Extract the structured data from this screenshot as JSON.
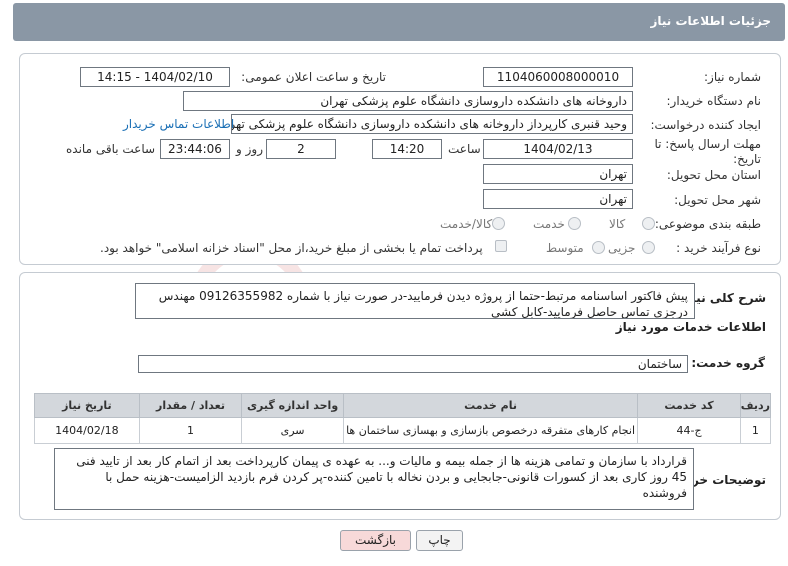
{
  "header": {
    "title": "جزئیات اطلاعات نیاز"
  },
  "need": {
    "number_label": "شماره نیاز:",
    "number_value": "1104060008000010",
    "announce_label": "تاریخ و ساعت اعلان عمومی:",
    "announce_value": "1404/02/10 - 14:15",
    "buyer_label": "نام دستگاه خریدار:",
    "buyer_value": "داروخانه های دانشکده داروسازی دانشگاه علوم پزشکی تهران",
    "creator_label": "ایجاد کننده درخواست:",
    "creator_value": "وحید قنبری کارپرداز داروخانه های دانشکده داروسازی دانشگاه علوم پزشکی تهران",
    "contact_link": "اطلاعات تماس خریدار",
    "deadline_label": "مهلت ارسال پاسخ: تا تاریخ:",
    "deadline_date": "1404/02/13",
    "time_label": "ساعت",
    "deadline_time": "14:20",
    "days_value": "2",
    "days_label": "روز و",
    "remaining_time": "23:44:06",
    "remaining_label": "ساعت باقی مانده",
    "province_label": "استان محل تحویل:",
    "province_value": "تهران",
    "city_label": "شهر محل تحویل:",
    "city_value": "تهران",
    "category_label": "طبقه بندی موضوعی:",
    "category_options": [
      "کالا",
      "خدمت",
      "کالا/خدمت"
    ],
    "process_label": "نوع فرآیند خرید :",
    "process_options": [
      "جزیی",
      "متوسط"
    ],
    "payment_note": "پرداخت تمام یا بخشی از مبلغ خرید،از محل \"اسناد خزانه اسلامی\" خواهد بود."
  },
  "description": {
    "label": "شرح کلی نیاز:",
    "text": "پیش فاکتور اساسنامه مرتبط-حتما از پروژه دیدن فرمایید-در صورت نیاز با شماره 09126355982 مهندس درجزی تماس حاصل فرمایید-کابل کشی"
  },
  "services": {
    "section_title": "اطلاعات خدمات مورد نیاز",
    "group_label": "گروه خدمت:",
    "group_value": "ساختمان",
    "columns": [
      "ردیف",
      "کد خدمت",
      "نام خدمت",
      "واحد اندازه گیری",
      "تعداد / مقدار",
      "تاریخ نیاز"
    ],
    "rows": [
      [
        "1",
        "ج-44",
        "انجام کارهای متفرقه درخصوص بازسازی و بهسازی ساختمان ها",
        "سری",
        "1",
        "1404/02/18"
      ]
    ]
  },
  "buyer_notes": {
    "label": "توضیحات خریدار:",
    "text": "قرارداد با سازمان و تمامی هزینه ها از جمله بیمه و مالیات و... به عهده ی پیمان کارپرداخت بعد از اتمام کار بعد از تایید فنی 45 روز کاری بعد از کسورات قانونی-جابجایی و بردن نخاله با تامین کننده-پر کردن فرم بازدید الزامیست-هزینه حمل با فروشنده"
  },
  "buttons": {
    "print": "چاپ",
    "back": "بازگشت"
  },
  "watermark": {
    "text": "AriaTender.neT"
  }
}
